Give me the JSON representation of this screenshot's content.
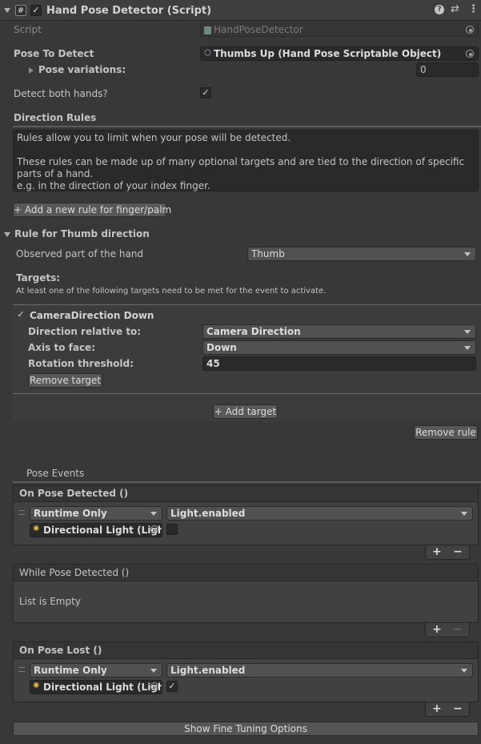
{
  "header": {
    "title": "Hand Pose Detector (Script)",
    "enabled": true
  },
  "script": {
    "label": "Script",
    "value": "HandPoseDetector"
  },
  "pose_to_detect": {
    "label": "Pose To Detect",
    "value": "Thumbs Up (Hand Pose Scriptable Object)"
  },
  "pose_variations": {
    "label": "Pose variations:",
    "value": "0"
  },
  "detect_both_hands": {
    "label": "Detect both hands?",
    "checked": true
  },
  "direction_rules": {
    "title": "Direction Rules",
    "help_text": "Rules allow you to limit when your pose will be detected.\n\nThese rules can be made up of many optional targets and are tied to the direction of specific parts of a hand.\ne.g. in the direction of your index finger.",
    "add_rule_label": "+ Add a new rule for finger/palm"
  },
  "rule": {
    "title": "Rule for Thumb direction",
    "observed_label": "Observed part of the hand",
    "observed_value": "Thumb",
    "targets_label": "Targets:",
    "targets_hint": "At least one of the following targets need to be met for the event to activate.",
    "target": {
      "name": "CameraDirection Down",
      "enabled": true,
      "relative_label": "Direction relative to:",
      "relative_value": "Camera Direction",
      "axis_label": "Axis to face:",
      "axis_value": "Down",
      "threshold_label": "Rotation threshold:",
      "threshold_value": "45",
      "remove_label": "Remove target"
    },
    "add_target_label": "+ Add target",
    "remove_rule_label": "Remove rule"
  },
  "pose_events": {
    "title": "Pose Events",
    "on_detected": {
      "header": "On Pose Detected ()",
      "runtime": "Runtime Only",
      "function": "Light.enabled",
      "object": "Directional Light (Light)",
      "checked": false
    },
    "while_detected": {
      "header": "While Pose Detected ()",
      "empty": "List is Empty"
    },
    "on_lost": {
      "header": "On Pose Lost ()",
      "runtime": "Runtime Only",
      "function": "Light.enabled",
      "object": "Directional Light (Light)",
      "checked": true
    },
    "plus": "+",
    "minus": "−"
  },
  "fine_tuning_label": "Show Fine Tuning Options",
  "colors": {
    "background": "#383838",
    "field": "#2a2a2a",
    "button": "#585858",
    "light_icon": "#e2b84c"
  }
}
